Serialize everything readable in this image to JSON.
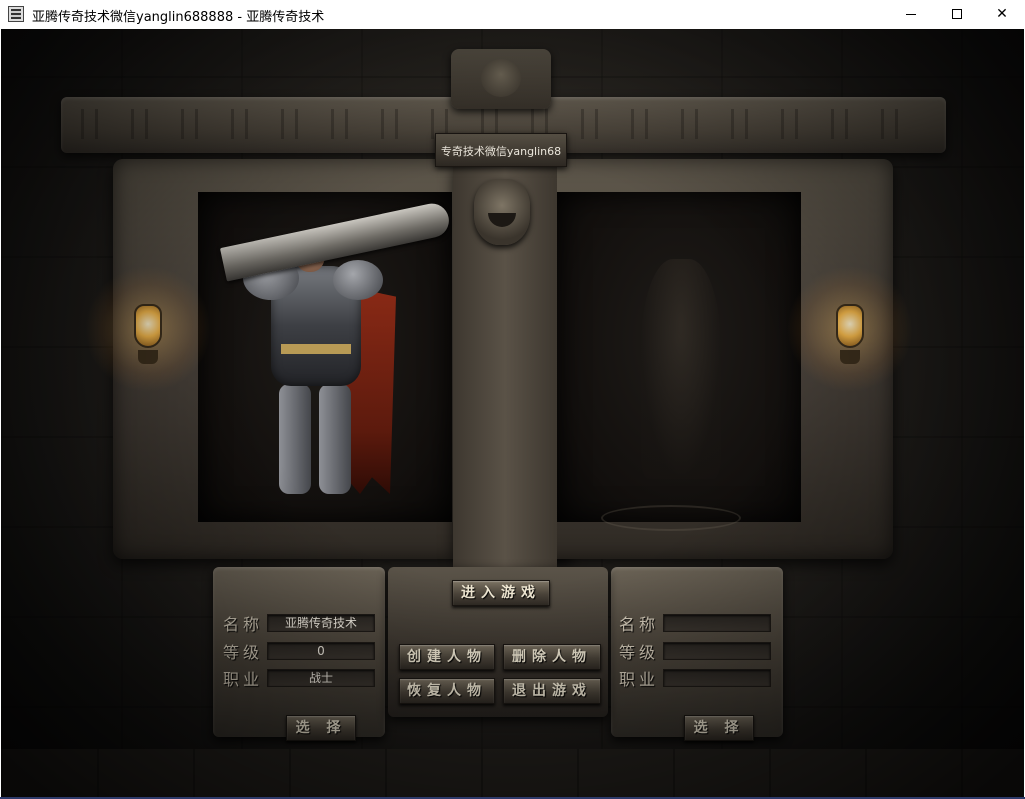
{
  "window": {
    "title": "亚腾传奇技术微信yanglin688888 - 亚腾传奇技术",
    "icon": "app-icon",
    "controls": {
      "minimize": "minimize-icon",
      "maximize": "maximize-icon",
      "close": "✕"
    }
  },
  "server": {
    "label": "专奇技术微信yanglin68"
  },
  "left_character": {
    "name_label": "名称",
    "name_value": "亚腾传奇技术",
    "level_label": "等级",
    "level_value": "0",
    "class_label": "职业",
    "class_value": "战士",
    "select_label": "选 择"
  },
  "right_character": {
    "name_label": "名称",
    "name_value": "",
    "level_label": "等级",
    "level_value": "",
    "class_label": "职业",
    "class_value": "",
    "select_label": "选 择"
  },
  "menu": {
    "enter_game": "进入游戏",
    "create_character": "创建人物",
    "delete_character": "删除人物",
    "restore_character": "恢复人物",
    "exit_game": "退出游戏"
  },
  "colors": {
    "lamp_glow": "#f2b64a",
    "cape": "#8b2a16",
    "text": "#f1e9d4"
  }
}
